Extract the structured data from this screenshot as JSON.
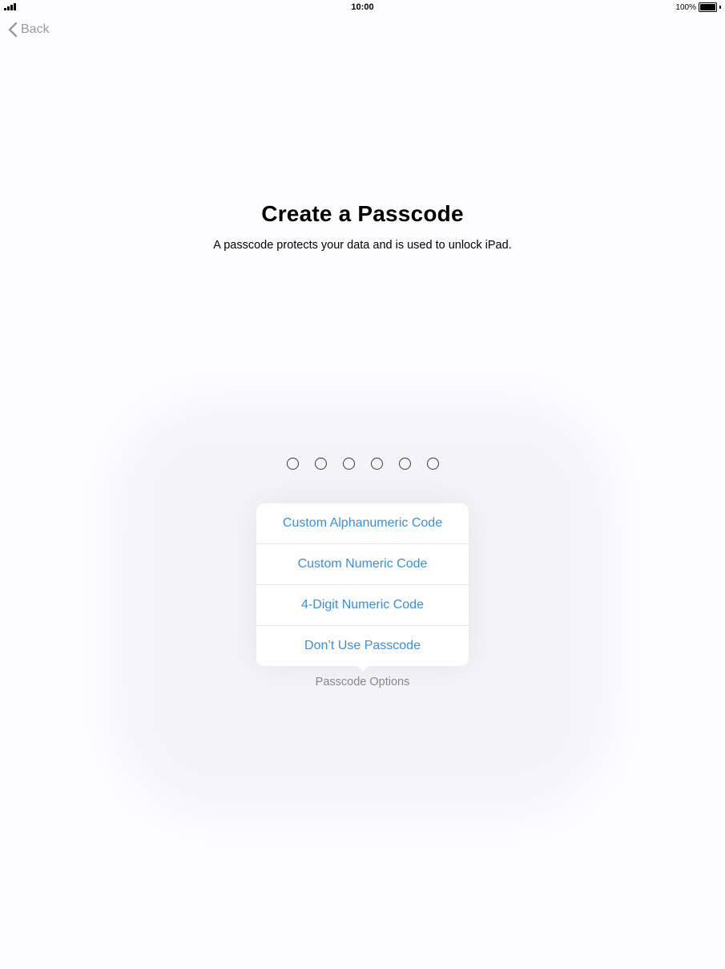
{
  "status_bar": {
    "time": "10:00",
    "battery_percent": "100%"
  },
  "nav": {
    "back_label": "Back"
  },
  "header": {
    "title": "Create a Passcode",
    "subtitle": "A passcode protects your data and is used to unlock iPad."
  },
  "passcode": {
    "digit_count": 6
  },
  "passcode_options": {
    "items": [
      {
        "label": "Custom Alphanumeric Code"
      },
      {
        "label": "Custom Numeric Code"
      },
      {
        "label": "4-Digit Numeric Code"
      },
      {
        "label": "Don’t Use Passcode"
      }
    ],
    "label": "Passcode Options"
  },
  "colors": {
    "accent": "#3a8fdb",
    "back_gray": "#9a99a0",
    "background": "#fdfcfe"
  }
}
